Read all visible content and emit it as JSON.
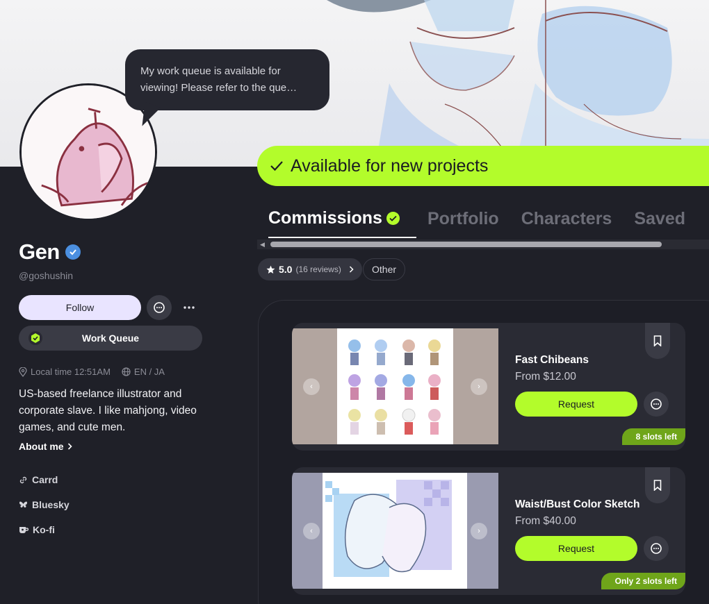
{
  "profile": {
    "name": "Gen",
    "handle": "@goshushin",
    "bubble_text": "My work queue is available for viewing! Please refer to the que…",
    "follow_label": "Follow",
    "work_queue_label": "Work Queue",
    "local_time": "Local time 12:51AM",
    "languages": "EN / JA",
    "bio": "US-based freelance illustrator and corporate slave. I like mahjong, video games, and cute men.",
    "about_label": "About me",
    "links": [
      "Carrd",
      "Bluesky",
      "Ko-fi"
    ]
  },
  "status": {
    "available_label": "Available for new projects",
    "accent_color": "#b3fc2b"
  },
  "tabs": [
    {
      "label": "Commissions",
      "active": true
    },
    {
      "label": "Portfolio",
      "active": false
    },
    {
      "label": "Characters",
      "active": false
    },
    {
      "label": "Saved",
      "active": false
    }
  ],
  "filters": {
    "rating": "5.0",
    "reviews": "(16 reviews)",
    "other": "Other"
  },
  "commissions": [
    {
      "title": "Fast Chibeans",
      "price": "From $12.00",
      "request_label": "Request",
      "slots": "8 slots left"
    },
    {
      "title": "Waist/Bust Color Sketch",
      "price": "From $40.00",
      "request_label": "Request",
      "slots": "Only 2 slots left"
    }
  ]
}
